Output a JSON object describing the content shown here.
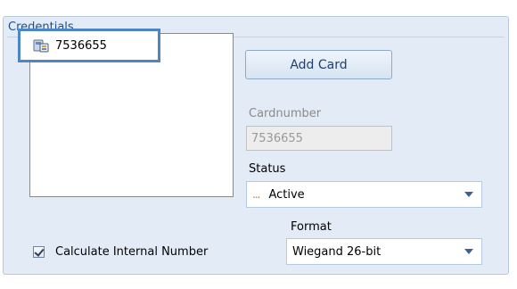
{
  "panel": {
    "title": "Credentials"
  },
  "cards": {
    "items": [
      {
        "label": "7536655",
        "icon": "card-reader-icon"
      }
    ]
  },
  "actions": {
    "add_card_label": "Add Card"
  },
  "fields": {
    "cardnumber_label": "Cardnumber",
    "cardnumber_value": "7536655",
    "status_label": "Status",
    "status_prefix": "...",
    "status_value": "Active",
    "format_label": "Format",
    "format_value": "Wiegand 26-bit"
  },
  "options": {
    "calculate_internal_label": "Calculate Internal Number",
    "calculate_internal_checked": true
  },
  "colors": {
    "panel_bg": "#e3ecf6",
    "title_color": "#1f4f8f",
    "selection_border": "#4a86c8",
    "status_dots": "#b07a2a"
  }
}
